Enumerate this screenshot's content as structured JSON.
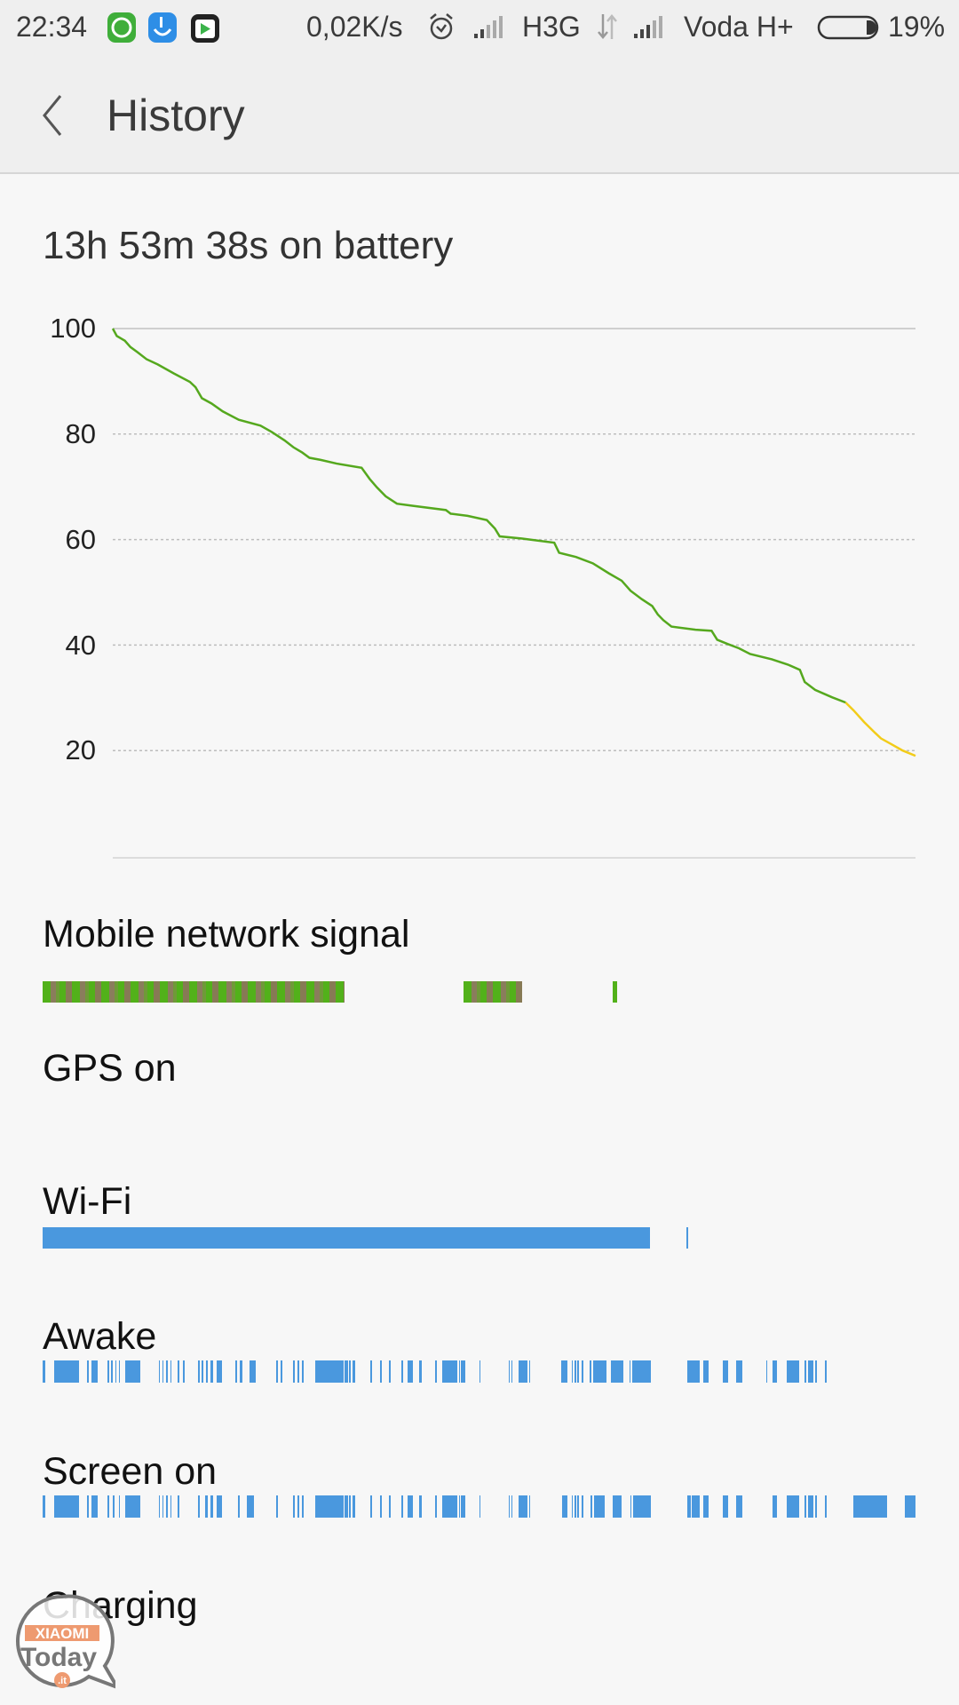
{
  "status_bar": {
    "time": "22:34",
    "notification_icons": [
      "whatsapp-icon",
      "touchpal-keyboard-icon",
      "play-store-icon"
    ],
    "net_speed": "0,02K/s",
    "sim1_network": "H3G",
    "sim2_network": "Voda H+",
    "battery_percent": "19%",
    "battery_level": 19
  },
  "header": {
    "title": "History",
    "back_icon": "chevron-left-icon"
  },
  "summary": "13h 53m 38s on battery",
  "colors": {
    "line_green": "#55a81e",
    "line_yellow": "#f2cc1a",
    "bar_blue": "#4a98de",
    "signal_green": "#52b11a",
    "signal_olive": "#8a7d5c"
  },
  "chart_data": {
    "type": "line",
    "title": "",
    "xlabel": "",
    "ylabel": "",
    "ylim": [
      0,
      100
    ],
    "xlim": [
      0,
      100
    ],
    "y_ticks": [
      "100",
      "80",
      "60",
      "40",
      "20"
    ],
    "grid": "horizontal dotted",
    "series": [
      {
        "x": [
          0,
          0.5,
          1.5,
          2.2,
          3.1,
          4.2,
          5.6,
          7.6,
          9.6,
          10.3,
          11.1,
          12.3,
          13.7,
          15.7,
          18.4,
          19.8,
          21.4,
          22.5,
          23.6,
          24.5,
          25.9,
          27.9,
          31.0,
          32.0,
          32.9,
          34.0,
          35.4,
          37.4,
          41.5,
          42.1,
          44.2,
          46.6,
          47.6,
          48.2,
          50.9,
          55.0,
          55.6,
          57.7,
          59.8,
          61.8,
          63.4,
          64.5,
          65.9,
          67.2,
          67.9,
          68.6,
          69.6,
          72.6,
          74.6,
          75.3,
          76.6,
          78.0,
          79.4,
          82.1,
          84.1,
          85.6,
          86.2,
          87.5,
          89.6,
          91.3,
          92.3,
          93.6,
          95.0,
          95.7,
          97.0,
          98.4,
          100
        ],
        "y": [
          100,
          98.6,
          97.7,
          96.5,
          95.5,
          94.2,
          93.2,
          91.5,
          89.9,
          88.9,
          86.8,
          85.8,
          84.3,
          82.7,
          81.6,
          80.4,
          78.8,
          77.5,
          76.5,
          75.5,
          75.1,
          74.4,
          73.6,
          71.5,
          69.9,
          68.2,
          66.8,
          66.4,
          65.6,
          64.9,
          64.5,
          63.7,
          62.1,
          60.6,
          60.2,
          59.4,
          57.5,
          56.7,
          55.5,
          53.6,
          52.2,
          50.3,
          48.7,
          47.4,
          45.8,
          44.7,
          43.5,
          42.9,
          42.7,
          41.0,
          40.2,
          39.4,
          38.3,
          37.3,
          36.3,
          35.3,
          33.0,
          31.5,
          30.1,
          29.1,
          27.6,
          25.4,
          23.3,
          22.3,
          21.2,
          20.0,
          19
        ]
      }
    ]
  },
  "sections": {
    "mobile_signal": {
      "label": "Mobile network signal",
      "segments": [
        [
          0,
          34.6
        ],
        [
          48.2,
          54.9
        ],
        [
          65.3,
          65.8
        ]
      ]
    },
    "gps": {
      "label": "GPS on",
      "segments": []
    },
    "wifi": {
      "label": "Wi-Fi",
      "segments": [
        [
          0,
          69.6
        ],
        [
          73.8,
          73.95
        ]
      ]
    },
    "awake": {
      "label": "Awake",
      "segments": [
        [
          0,
          0.3
        ],
        [
          1.3,
          4.2
        ],
        [
          5.1,
          5.3
        ],
        [
          5.6,
          6.3
        ],
        [
          7.4,
          7.6
        ],
        [
          7.8,
          8.0
        ],
        [
          8.3,
          8.4
        ],
        [
          8.7,
          8.9
        ],
        [
          9.5,
          11.2
        ],
        [
          13.3,
          13.4
        ],
        [
          13.7,
          13.8
        ],
        [
          14.1,
          14.3
        ],
        [
          14.6,
          14.8
        ],
        [
          15.5,
          15.6
        ],
        [
          16.1,
          16.3
        ],
        [
          17.8,
          18.0
        ],
        [
          18.2,
          18.4
        ],
        [
          18.7,
          18.9
        ],
        [
          19.2,
          19.5
        ],
        [
          19.9,
          20.5
        ],
        [
          22.1,
          22.2
        ],
        [
          22.6,
          22.9
        ],
        [
          23.7,
          24.4
        ],
        [
          26.8,
          27.0
        ],
        [
          27.3,
          27.5
        ],
        [
          28.7,
          28.9
        ],
        [
          29.2,
          29.4
        ],
        [
          29.7,
          29.9
        ],
        [
          31.2,
          34.5
        ],
        [
          34.6,
          35.0
        ],
        [
          35.1,
          35.3
        ],
        [
          35.5,
          35.8
        ],
        [
          37.5,
          37.7
        ],
        [
          38.7,
          38.9
        ],
        [
          39.7,
          39.9
        ],
        [
          41.1,
          41.2
        ],
        [
          41.8,
          42.4
        ],
        [
          43.1,
          43.4
        ],
        [
          45.0,
          45.1
        ],
        [
          45.8,
          47.5
        ],
        [
          47.7,
          47.8
        ],
        [
          47.9,
          48.4
        ],
        [
          50.0,
          50.1
        ],
        [
          53.4,
          53.5
        ],
        [
          53.7,
          53.8
        ],
        [
          54.5,
          55.5
        ],
        [
          55.7,
          55.9
        ],
        [
          59.4,
          60.1
        ],
        [
          60.6,
          60.7
        ],
        [
          60.9,
          61.1
        ],
        [
          61.2,
          61.4
        ],
        [
          61.7,
          62.0
        ],
        [
          62.7,
          62.9
        ],
        [
          63.1,
          64.6
        ],
        [
          65.1,
          66.5
        ],
        [
          67.2,
          67.3
        ],
        [
          67.5,
          69.7
        ],
        [
          73.9,
          75.3
        ],
        [
          75.7,
          76.3
        ],
        [
          77.9,
          78.5
        ],
        [
          79.5,
          80.2
        ],
        [
          82.9,
          83.0
        ],
        [
          83.6,
          84.1
        ],
        [
          85.2,
          86.7
        ],
        [
          87.3,
          87.5
        ],
        [
          87.7,
          88.3
        ],
        [
          88.5,
          88.7
        ],
        [
          89.6,
          89.8
        ]
      ]
    },
    "screen_on": {
      "label": "Screen on",
      "segments": [
        [
          0,
          0.3
        ],
        [
          1.3,
          4.2
        ],
        [
          5.1,
          5.3
        ],
        [
          5.6,
          6.3
        ],
        [
          7.4,
          7.6
        ],
        [
          8.0,
          8.2
        ],
        [
          8.7,
          8.9
        ],
        [
          9.5,
          11.2
        ],
        [
          13.3,
          13.4
        ],
        [
          13.7,
          13.8
        ],
        [
          14.1,
          14.3
        ],
        [
          14.6,
          14.8
        ],
        [
          15.5,
          15.6
        ],
        [
          17.8,
          18.0
        ],
        [
          18.6,
          18.9
        ],
        [
          19.2,
          19.5
        ],
        [
          19.9,
          20.5
        ],
        [
          22.4,
          22.6
        ],
        [
          23.4,
          24.2
        ],
        [
          26.8,
          27.0
        ],
        [
          28.7,
          28.9
        ],
        [
          29.2,
          29.4
        ],
        [
          29.7,
          29.9
        ],
        [
          31.2,
          34.5
        ],
        [
          34.6,
          35.0
        ],
        [
          35.1,
          35.3
        ],
        [
          35.5,
          35.8
        ],
        [
          37.5,
          37.7
        ],
        [
          38.7,
          38.9
        ],
        [
          39.7,
          39.9
        ],
        [
          41.1,
          41.2
        ],
        [
          41.8,
          42.4
        ],
        [
          43.1,
          43.4
        ],
        [
          45.0,
          45.1
        ],
        [
          45.8,
          47.5
        ],
        [
          47.7,
          47.8
        ],
        [
          47.9,
          48.4
        ],
        [
          50.0,
          50.1
        ],
        [
          53.4,
          53.5
        ],
        [
          53.7,
          53.8
        ],
        [
          54.5,
          55.5
        ],
        [
          55.7,
          55.9
        ],
        [
          59.5,
          60.1
        ],
        [
          60.6,
          60.7
        ],
        [
          60.9,
          61.1
        ],
        [
          61.2,
          61.4
        ],
        [
          61.7,
          62.0
        ],
        [
          62.8,
          63.0
        ],
        [
          63.2,
          64.4
        ],
        [
          65.3,
          66.3
        ],
        [
          67.3,
          67.4
        ],
        [
          67.6,
          69.7
        ],
        [
          73.9,
          74.3
        ],
        [
          74.4,
          75.3
        ],
        [
          75.7,
          76.3
        ],
        [
          77.9,
          78.5
        ],
        [
          79.5,
          80.2
        ],
        [
          83.6,
          84.1
        ],
        [
          85.2,
          86.7
        ],
        [
          87.3,
          87.5
        ],
        [
          87.7,
          88.3
        ],
        [
          88.5,
          88.7
        ],
        [
          89.6,
          89.8
        ],
        [
          92.9,
          96.7
        ],
        [
          98.8,
          100
        ]
      ]
    },
    "charging": {
      "label": "Charging",
      "segments": []
    }
  },
  "watermark": {
    "top": "XIAOMI",
    "main": "Today",
    "suffix": ".it"
  }
}
